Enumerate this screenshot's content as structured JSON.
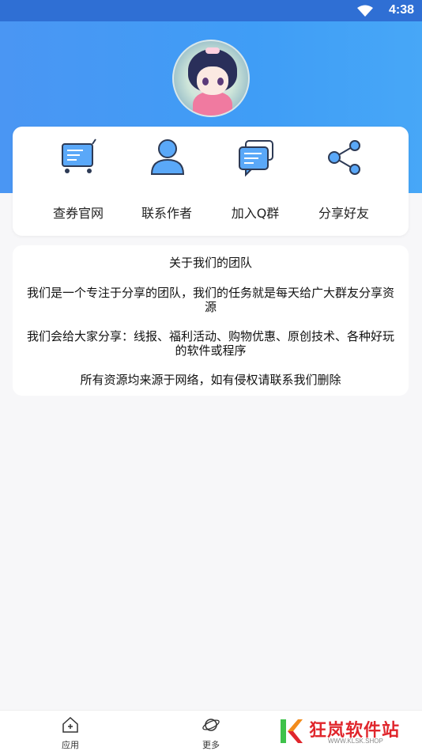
{
  "status_bar": {
    "time": "4:38",
    "wifi_icon": "wifi-icon"
  },
  "colors": {
    "header_blue": "#4a96f3",
    "icon_blue": "#5aa8f8",
    "watermark_red": "#e0262c"
  },
  "menu": {
    "items": [
      {
        "label": "查券官网",
        "icon": "shopping-cart-icon"
      },
      {
        "label": "联系作者",
        "icon": "person-icon"
      },
      {
        "label": "加入Q群",
        "icon": "chat-bubble-icon"
      },
      {
        "label": "分享好友",
        "icon": "share-icon"
      }
    ]
  },
  "about": {
    "title": "关于我们的团队",
    "para1_line1": "我们是一个专注于分享的团队，我们的任务就是每天给广大群友分享资",
    "para1_line2": "源",
    "para2_line1": "我们会给大家分享：线报、福利活动、购物优惠、原创技术、各种好玩",
    "para2_line2": "的软件或程序",
    "para3": "所有资源均来源于网络，如有侵权请联系我们删除"
  },
  "bottom_nav": {
    "items": [
      {
        "label": "应用",
        "icon": "home-icon"
      },
      {
        "label": "更多",
        "icon": "planet-icon"
      }
    ]
  },
  "watermark": {
    "text": "狂岚软件站",
    "url": "WWW.KLSK.SHOP"
  }
}
